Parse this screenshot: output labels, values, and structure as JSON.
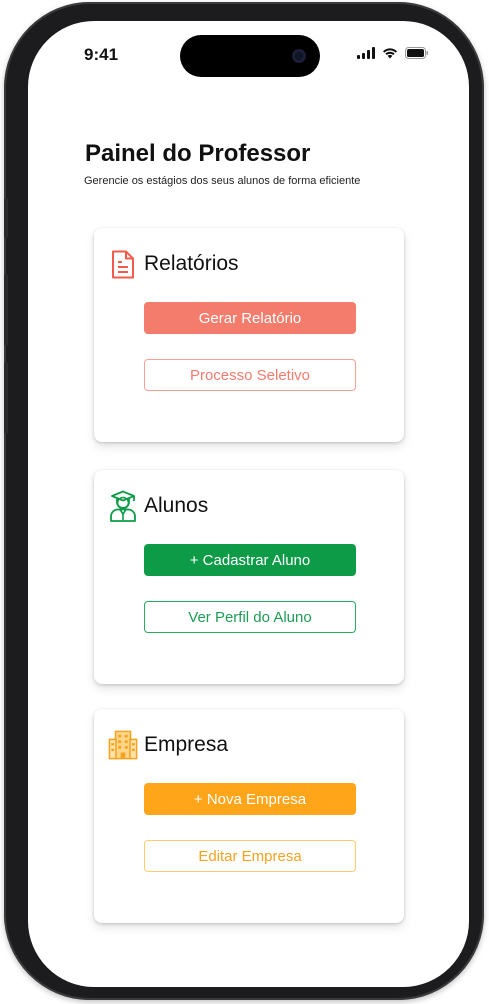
{
  "status_bar": {
    "time": "9:41",
    "icons": [
      "signal-icon",
      "wifi-icon",
      "battery-icon"
    ]
  },
  "page": {
    "title": "Painel do Professor",
    "subtitle": "Gerencie os estágios dos seus alunos de forma eficiente"
  },
  "cards": [
    {
      "title": "Relatórios",
      "icon": "document-icon",
      "accent": "#f47c6c",
      "primary_label": "Gerar Relatório",
      "secondary_label": "Processo Seletivo"
    },
    {
      "title": "Alunos",
      "icon": "graduate-icon",
      "accent": "#0e9b48",
      "primary_label": "+ Cadastrar Aluno",
      "secondary_label": "Ver Perfil do Aluno"
    },
    {
      "title": "Empresa",
      "icon": "building-icon",
      "accent": "#ffa51a",
      "primary_label": "+ Nova Empresa",
      "secondary_label": "Editar Empresa"
    }
  ]
}
